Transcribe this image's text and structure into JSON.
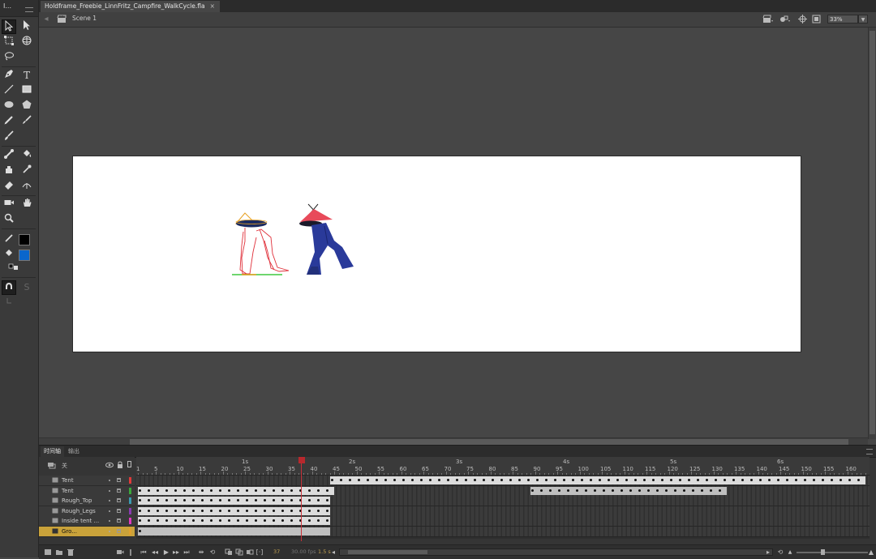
{
  "tools_panel": {
    "title": "I..."
  },
  "document": {
    "tab_title": "Holdframe_Freebie_LinnFritz_Campfire_WalkCycle.fla",
    "close_glyph": "×"
  },
  "edit_bar": {
    "scene_label": "Scene 1",
    "zoom_value": "33%",
    "icons": [
      "back-arrow-icon",
      "scene-icon",
      "edit-scene-icon",
      "edit-symbols-icon",
      "center-stage-icon",
      "clip-stage-icon"
    ]
  },
  "stage": {
    "background": "#ffffff",
    "characters": [
      {
        "name": "rough-sketch-character",
        "style": "outline",
        "colors": [
          "#e0303a",
          "#e8a020",
          "#1a2a60",
          "#3ec83e"
        ]
      },
      {
        "name": "colored-character",
        "style": "filled",
        "colors": [
          "#e84a5a",
          "#2a3a9a",
          "#1a1a2a"
        ]
      }
    ]
  },
  "timeline": {
    "tabs": [
      "时间轴",
      "输出"
    ],
    "active_tab": 0,
    "header_label": "关",
    "seconds_labels": [
      "1s",
      "2s",
      "3s",
      "4s",
      "5s",
      "6s"
    ],
    "frame_labels": [
      "1",
      "5",
      "10",
      "15",
      "20",
      "25",
      "30",
      "35",
      "40",
      "45",
      "50",
      "55",
      "60",
      "65",
      "70",
      "75",
      "80",
      "85",
      "90",
      "95",
      "100",
      "105",
      "110",
      "115",
      "120",
      "125",
      "130",
      "135",
      "140",
      "145",
      "150",
      "155",
      "160"
    ],
    "layers": [
      {
        "name": "Tent",
        "color": "#e03a3a",
        "active": false
      },
      {
        "name": "Tent",
        "color": "#3aa83a",
        "active": false
      },
      {
        "name": "Rough_Top",
        "color": "#3a9ab0",
        "active": false
      },
      {
        "name": "Rough_Legs",
        "color": "#8a3ab0",
        "active": false
      },
      {
        "name": "Inside tent ...",
        "color": "#e03ac0",
        "active": false
      },
      {
        "name": "Gro...",
        "color": "#e0a030",
        "active": true
      }
    ],
    "current_frame": "37",
    "frame_rate": "30.00 fps",
    "elapsed": "1.5 s"
  }
}
